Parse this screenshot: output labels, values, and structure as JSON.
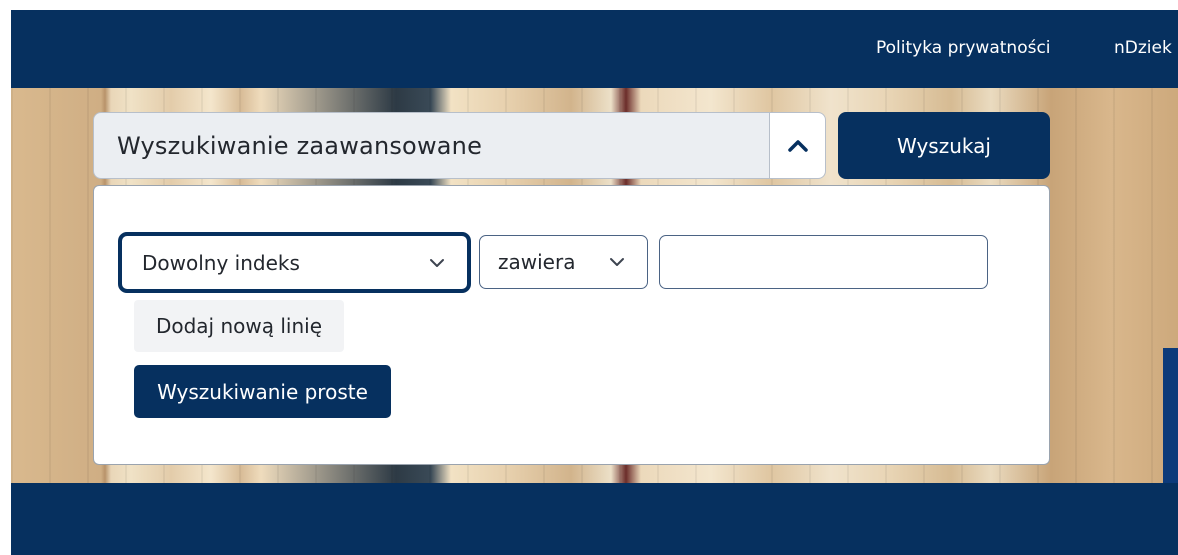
{
  "nav": {
    "privacy_label": "Polityka prywatności",
    "user_label": "nDziek"
  },
  "search": {
    "mode_label": "Wyszukiwanie zaawansowane",
    "toggle_icon": "chevron-up-icon",
    "submit_label": "Wyszukaj"
  },
  "advanced": {
    "index_select": {
      "selected": "Dowolny indeks",
      "icon": "chevron-down-icon"
    },
    "condition_select": {
      "selected": "zawiera",
      "icon": "chevron-down-icon"
    },
    "query_input": {
      "value": ""
    },
    "add_line_label": "Dodaj nową linię",
    "simple_search_label": "Wyszukiwanie proste"
  },
  "colors": {
    "primary": "#06305f",
    "panel_bg": "#ffffff",
    "search_bg": "#ebeef2"
  }
}
